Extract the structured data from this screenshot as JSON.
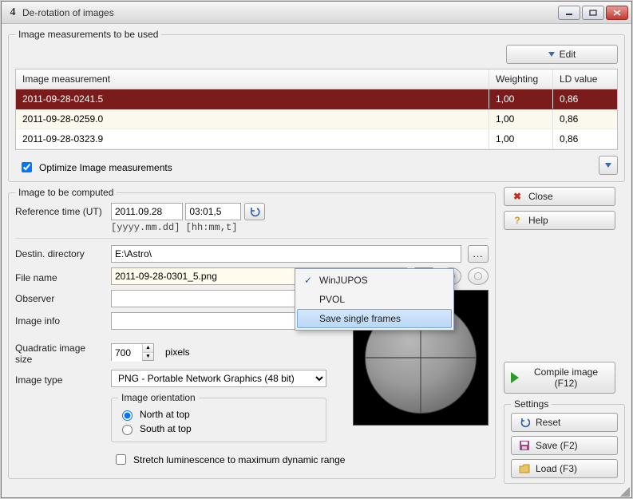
{
  "window": {
    "title": "De-rotation of images",
    "app_glyph": "4"
  },
  "measurements": {
    "legend": "Image measurements to be used",
    "edit_label": "Edit",
    "columns": {
      "measurement": "Image measurement",
      "weighting": "Weighting",
      "ld": "LD value"
    },
    "rows": [
      {
        "measurement": "2011-09-28-0241.5",
        "weighting": "1,00",
        "ld": "0,86",
        "selected": true
      },
      {
        "measurement": "2011-09-28-0259.0",
        "weighting": "1,00",
        "ld": "0,86",
        "selected": false
      },
      {
        "measurement": "2011-09-28-0323.9",
        "weighting": "1,00",
        "ld": "0,86",
        "selected": false
      }
    ],
    "optimize_label": "Optimize Image measurements",
    "optimize_checked": true
  },
  "compute": {
    "legend": "Image to be computed",
    "ref_time_label": "Reference time (UT)",
    "ref_date": "2011.09.28",
    "ref_time": "03:01,5",
    "ref_hint": "[yyyy.mm.dd] [hh:mm,t]",
    "dest_label": "Destin. directory",
    "dest_value": "E:\\Astro\\",
    "file_label": "File name",
    "file_value": "2011-09-28-0301_5.png",
    "observer_label": "Observer",
    "observer_value": "",
    "info_label": "Image info",
    "info_value": "",
    "size_label": "Quadratic image size",
    "size_value": "700",
    "size_unit": "pixels",
    "type_label": "Image type",
    "type_value": "PNG  - Portable Network Graphics (48 bit)",
    "orientation_legend": "Image orientation",
    "orientation_north": "North at top",
    "orientation_south": "South at top",
    "orientation_value": "north",
    "stretch_label": "Stretch luminescence to maximum dynamic range",
    "stretch_checked": false
  },
  "menu": {
    "items": [
      {
        "label": "WinJUPOS",
        "checked": true,
        "highlight": false
      },
      {
        "label": "PVOL",
        "checked": false,
        "highlight": false
      },
      {
        "label": "Save single frames",
        "checked": false,
        "highlight": true
      }
    ]
  },
  "side": {
    "close": "Close",
    "help": "Help",
    "compile": "Compile image (F12)",
    "settings_legend": "Settings",
    "reset": "Reset",
    "save": "Save (F2)",
    "load": "Load (F3)"
  }
}
